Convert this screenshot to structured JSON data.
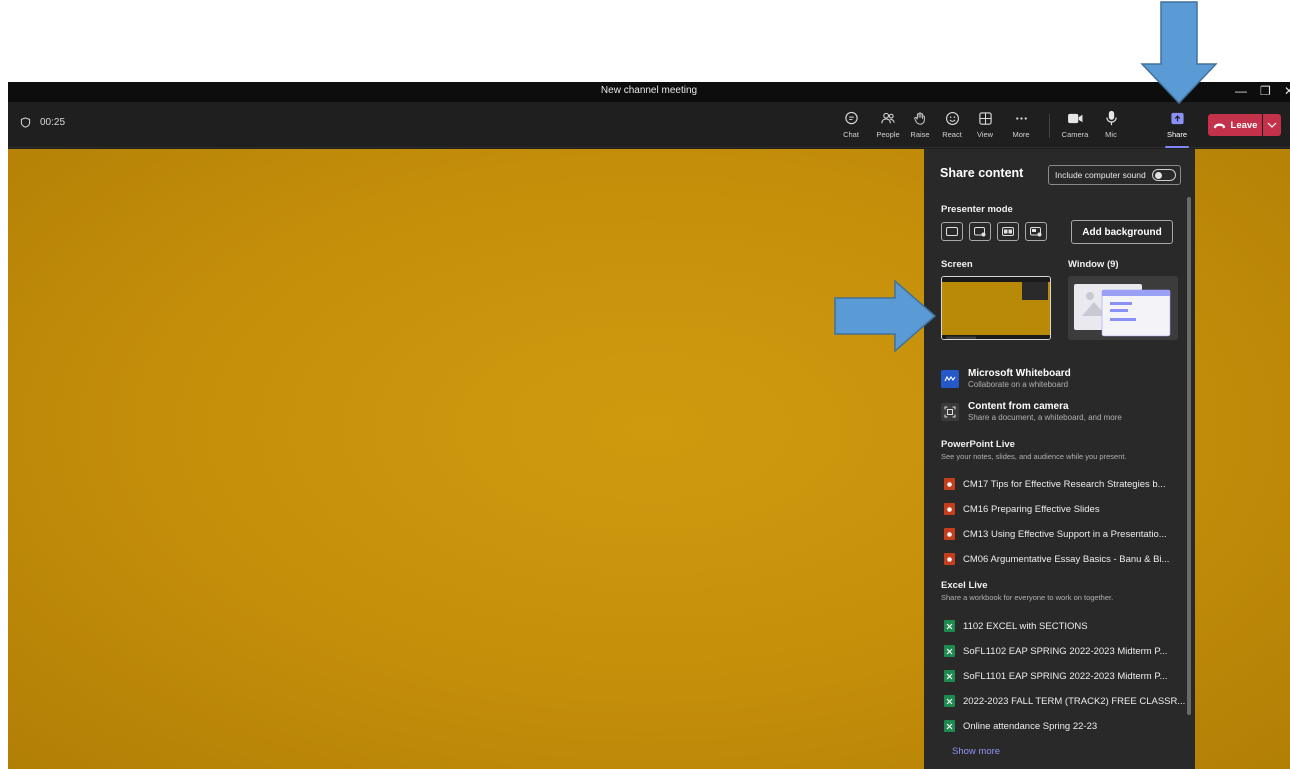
{
  "window": {
    "title": "New channel meeting",
    "minimize": "—",
    "maximize": "❐",
    "close": "✕"
  },
  "toolbar": {
    "timer": "00:25",
    "buttons": [
      {
        "label": "Chat",
        "icon": "chat-icon"
      },
      {
        "label": "People",
        "icon": "people-icon"
      },
      {
        "label": "Raise",
        "icon": "raise-hand-icon"
      },
      {
        "label": "React",
        "icon": "smile-icon"
      },
      {
        "label": "View",
        "icon": "grid-icon"
      },
      {
        "label": "More",
        "icon": "more-icon"
      },
      {
        "label": "Camera",
        "icon": "camera-icon"
      },
      {
        "label": "Mic",
        "icon": "mic-icon"
      },
      {
        "label": "Share",
        "icon": "share-icon"
      }
    ],
    "leave_label": "Leave"
  },
  "share_panel": {
    "title": "Share content",
    "include_sound_label": "Include computer sound",
    "presenter_mode_label": "Presenter mode",
    "add_background_label": "Add background",
    "screen_label": "Screen",
    "window_label": "Window (9)",
    "whiteboard": {
      "title": "Microsoft Whiteboard",
      "subtitle": "Collaborate on a whiteboard"
    },
    "camera_content": {
      "title": "Content from camera",
      "subtitle": "Share a document, a whiteboard, and more"
    },
    "powerpoint": {
      "title": "PowerPoint Live",
      "subtitle": "See your notes, slides, and audience while you present.",
      "files": [
        "CM17 Tips for Effective Research Strategies b...",
        "CM16 Preparing Effective Slides",
        "CM13 Using Effective Support in a Presentatio...",
        "CM06 Argumentative Essay Basics - Banu & Bi..."
      ]
    },
    "excel": {
      "title": "Excel Live",
      "subtitle": "Share a workbook for everyone to work on together.",
      "files": [
        "1102 EXCEL with SECTIONS",
        "SoFL1102 EAP SPRING 2022-2023 Midterm P...",
        "SoFL1101 EAP SPRING 2022-2023 Midterm P...",
        "2022-2023 FALL TERM (TRACK2) FREE CLASSR...",
        "Online attendance Spring 22-23"
      ]
    },
    "show_more": "Show more"
  },
  "colors": {
    "leave": "#c4314b",
    "accent": "#7f85f5",
    "video": "#c48e0a",
    "annotation_arrow": "#5b9bd5",
    "powerpoint": "#c43e1c",
    "excel": "#1d8a4e"
  }
}
